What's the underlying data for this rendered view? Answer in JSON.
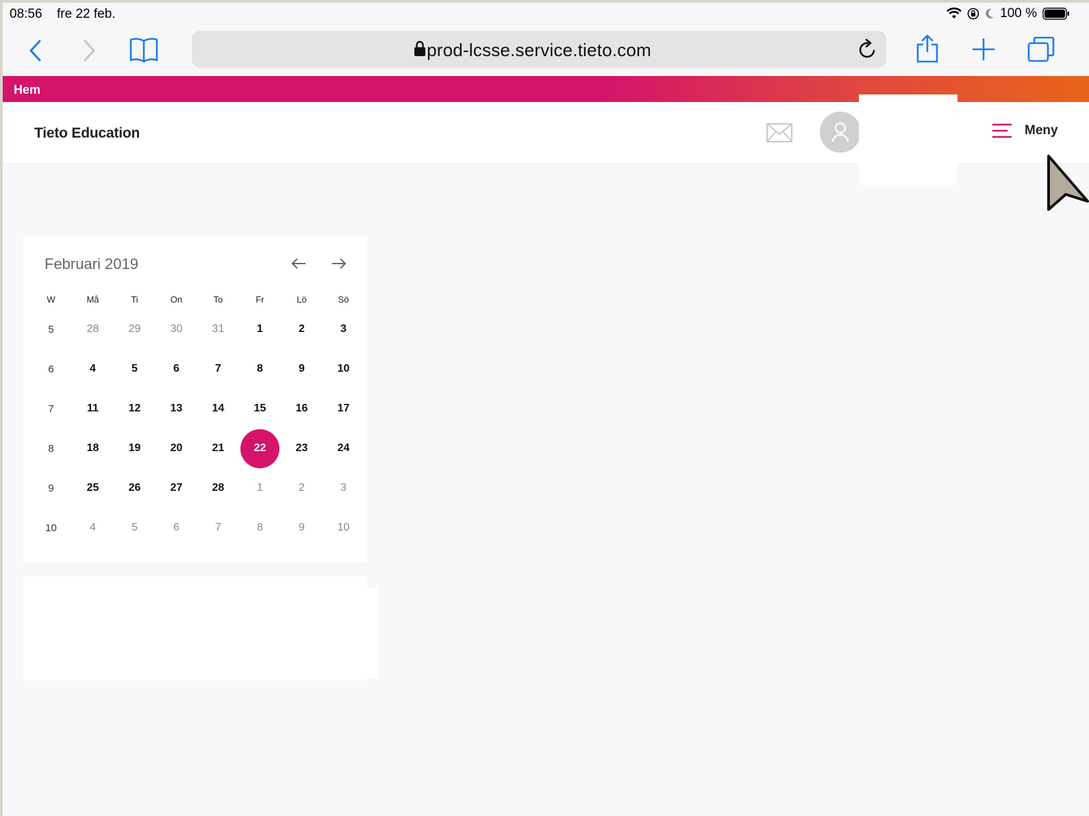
{
  "status_bar": {
    "time": "08:56",
    "date": "fre 22 feb.",
    "battery": "100 %"
  },
  "browser": {
    "url": "prod-lcsse.service.tieto.com"
  },
  "brand_strip": {
    "home": "Hem"
  },
  "header": {
    "brand": "Tieto Education",
    "menu_label": "Meny"
  },
  "colors": {
    "accent": "#d4136b",
    "gradient_end": "#e8641a"
  },
  "calendar": {
    "title": "Februari 2019",
    "headers": [
      "W",
      "Må",
      "Ti",
      "On",
      "To",
      "Fr",
      "Lö",
      "Sö"
    ],
    "selected": "22",
    "weeks": [
      {
        "week": "5",
        "days": [
          {
            "d": "28",
            "cur": false
          },
          {
            "d": "29",
            "cur": false
          },
          {
            "d": "30",
            "cur": false
          },
          {
            "d": "31",
            "cur": false
          },
          {
            "d": "1",
            "cur": true
          },
          {
            "d": "2",
            "cur": true
          },
          {
            "d": "3",
            "cur": true
          }
        ]
      },
      {
        "week": "6",
        "days": [
          {
            "d": "4",
            "cur": true
          },
          {
            "d": "5",
            "cur": true
          },
          {
            "d": "6",
            "cur": true
          },
          {
            "d": "7",
            "cur": true
          },
          {
            "d": "8",
            "cur": true
          },
          {
            "d": "9",
            "cur": true
          },
          {
            "d": "10",
            "cur": true
          }
        ]
      },
      {
        "week": "7",
        "days": [
          {
            "d": "11",
            "cur": true
          },
          {
            "d": "12",
            "cur": true
          },
          {
            "d": "13",
            "cur": true
          },
          {
            "d": "14",
            "cur": true
          },
          {
            "d": "15",
            "cur": true
          },
          {
            "d": "16",
            "cur": true
          },
          {
            "d": "17",
            "cur": true
          }
        ]
      },
      {
        "week": "8",
        "days": [
          {
            "d": "18",
            "cur": true
          },
          {
            "d": "19",
            "cur": true
          },
          {
            "d": "20",
            "cur": true
          },
          {
            "d": "21",
            "cur": true
          },
          {
            "d": "22",
            "cur": true
          },
          {
            "d": "23",
            "cur": true
          },
          {
            "d": "24",
            "cur": true
          }
        ]
      },
      {
        "week": "9",
        "days": [
          {
            "d": "25",
            "cur": true
          },
          {
            "d": "26",
            "cur": true
          },
          {
            "d": "27",
            "cur": true
          },
          {
            "d": "28",
            "cur": true
          },
          {
            "d": "1",
            "cur": false
          },
          {
            "d": "2",
            "cur": false
          },
          {
            "d": "3",
            "cur": false
          }
        ]
      },
      {
        "week": "10",
        "days": [
          {
            "d": "4",
            "cur": false
          },
          {
            "d": "5",
            "cur": false
          },
          {
            "d": "6",
            "cur": false
          },
          {
            "d": "7",
            "cur": false
          },
          {
            "d": "8",
            "cur": false
          },
          {
            "d": "9",
            "cur": false
          },
          {
            "d": "10",
            "cur": false
          }
        ]
      }
    ]
  }
}
